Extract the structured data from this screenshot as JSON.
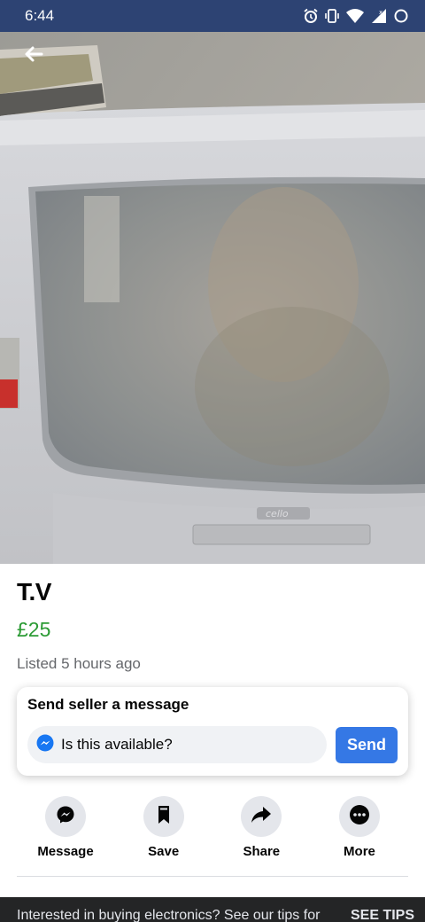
{
  "status_bar": {
    "time": "6:44",
    "icons": [
      "alarm-icon",
      "vibrate-icon",
      "wifi-icon",
      "signal-icon",
      "battery-icon"
    ]
  },
  "listing": {
    "title": "T.V",
    "price": "£25",
    "listed": "Listed 5 hours ago",
    "photo_brand_text": "cello"
  },
  "message_card": {
    "heading": "Send seller a message",
    "input_value": "Is this available?",
    "send_label": "Send"
  },
  "actions": [
    {
      "label": "Message",
      "icon": "messenger-icon"
    },
    {
      "label": "Save",
      "icon": "bookmark-icon"
    },
    {
      "label": "Share",
      "icon": "share-icon"
    },
    {
      "label": "More",
      "icon": "more-icon"
    }
  ],
  "banner": {
    "text": "Interested in buying electronics? See our tips for",
    "link": "SEE TIPS"
  },
  "colors": {
    "status_bar": "#2d4373",
    "price": "#2c9b35",
    "send_button": "#3578e5",
    "banner": "#242526"
  }
}
